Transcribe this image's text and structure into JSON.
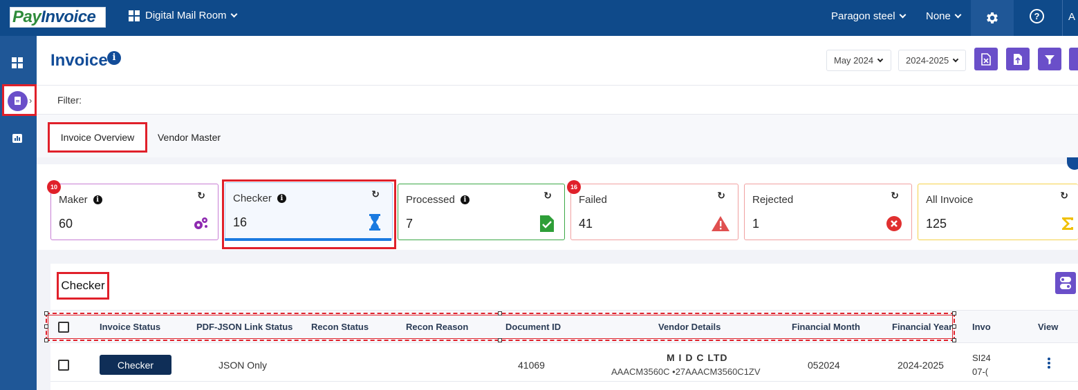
{
  "topbar": {
    "logo_pay": "Pay",
    "logo_inv": "Invoice",
    "app_name": "Digital Mail Room",
    "company": "Paragon steel",
    "branch": "None",
    "user_initial": "A"
  },
  "icons": {
    "settings": "gear-icon",
    "help": "question-circle-icon",
    "dashboard": "dashboard-grid-icon",
    "invoice": "document-icon",
    "reports": "bar-chart-icon"
  },
  "header": {
    "title": "Invoice",
    "info_glyph": "i",
    "month": "May 2024",
    "year": "2024-2025"
  },
  "filter": {
    "label": "Filter:"
  },
  "tabs": [
    {
      "label": "Invoice Overview",
      "active": true
    },
    {
      "label": "Vendor Master",
      "active": false
    }
  ],
  "cards": [
    {
      "title": "Maker",
      "count": "60",
      "badge": "10",
      "info": true,
      "color": "#9c27b0"
    },
    {
      "title": "Checker",
      "count": "16",
      "badge": "",
      "info": true,
      "color": "#1a7ae0"
    },
    {
      "title": "Processed",
      "count": "7",
      "badge": "",
      "info": true,
      "color": "#2e9e38"
    },
    {
      "title": "Failed",
      "count": "41",
      "badge": "16",
      "info": false,
      "color": "#e05050"
    },
    {
      "title": "Rejected",
      "count": "1",
      "badge": "",
      "info": false,
      "color": "#e03030"
    },
    {
      "title": "All Invoice",
      "count": "125",
      "badge": "",
      "info": false,
      "color": "#f0c000"
    }
  ],
  "grid": {
    "title": "Checker",
    "columns": [
      "Invoice Status",
      "PDF-JSON Link Status",
      "Recon Status",
      "Recon Reason",
      "Document ID",
      "Vendor Details",
      "Financial Month",
      "Financial Year",
      "Invo",
      "View"
    ],
    "rows": [
      {
        "status": "Checker",
        "pdf_json": "JSON Only",
        "recon_status": "",
        "recon_reason": "",
        "doc_id": "41069",
        "vendor_name": "M I D C LTD",
        "vendor_ids": "AAACM3560C  •27AAACM3560C1ZV",
        "fin_month": "052024",
        "fin_year": "2024-2025",
        "invoice_line1": "SI24",
        "invoice_line2": "07-("
      }
    ]
  }
}
